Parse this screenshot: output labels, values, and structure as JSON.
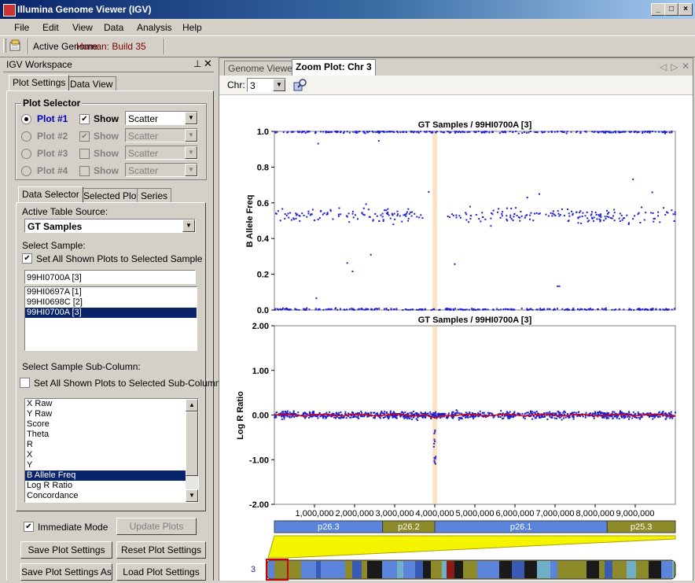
{
  "window": {
    "title": "Illumina Genome Viewer (IGV)"
  },
  "menu": [
    "File",
    "Edit",
    "View",
    "Data",
    "Analysis",
    "Help"
  ],
  "toolbar": {
    "genome_label": "Active Genome:",
    "genome_value": "Human: Build 35"
  },
  "workspace": {
    "title": "IGV Workspace",
    "tabs": [
      "Plot Settings",
      "Data View"
    ],
    "plot_selector": {
      "title": "Plot Selector",
      "rows": [
        {
          "plot": "Plot #1",
          "show": "Show",
          "type": "Scatter",
          "selected": true,
          "show_checked": true,
          "enabled": true
        },
        {
          "plot": "Plot #2",
          "show": "Show",
          "type": "Scatter",
          "selected": false,
          "show_checked": true,
          "enabled": false
        },
        {
          "plot": "Plot #3",
          "show": "Show",
          "type": "Scatter",
          "selected": false,
          "show_checked": false,
          "enabled": false
        },
        {
          "plot": "Plot #4",
          "show": "Show",
          "type": "Scatter",
          "selected": false,
          "show_checked": false,
          "enabled": false
        }
      ]
    },
    "subtabs": [
      "Data Selector",
      "Selected Plot",
      "Series"
    ],
    "table_source_label": "Active Table Source:",
    "table_source_value": "GT Samples",
    "select_sample_label": "Select Sample:",
    "set_all_sample_label": "Set All Shown Plots to Selected Sample",
    "sample_input": "99HI0700A [3]",
    "samples": [
      "99HI0697A [1]",
      "99HI0698C [2]",
      "99HI0700A [3]"
    ],
    "selected_sample_index": 2,
    "subcolumn_label": "Select Sample Sub-Column:",
    "set_all_subcolumn_label": "Set All Shown Plots to Selected Sub-Column",
    "subcolumns": [
      "X Raw",
      "Y Raw",
      "Score",
      "Theta",
      "R",
      "X",
      "Y",
      "B Allele Freq",
      "Log R Ratio",
      "Concordance"
    ],
    "selected_subcolumn_index": 7,
    "immediate_mode": "Immediate Mode",
    "update_plots": "Update Plots",
    "save_settings": "Save Plot Settings",
    "reset_settings": "Reset Plot Settings",
    "save_settings_as": "Save Plot Settings As",
    "load_settings": "Load Plot Settings"
  },
  "viewer": {
    "tabs": [
      "Genome Viewer",
      "Zoom Plot: Chr 3"
    ],
    "chr_label": "Chr:",
    "chr_value": "3",
    "chromosome_number": "3",
    "colors": {
      "points": "#2020d0",
      "trend": "#e00000",
      "highlight": "#fbe3c8"
    }
  },
  "chart_data": [
    {
      "type": "scatter",
      "title": "GT Samples / 99HI0700A [3]",
      "ylabel": "B Allele Freq",
      "ylim": [
        0,
        1
      ],
      "yticks": [
        "0.0",
        "0.2",
        "0.4",
        "0.6",
        "0.8",
        "1.0"
      ],
      "xlim": [
        0,
        10000000
      ],
      "clusters": [
        {
          "name": "homozygous A",
          "y": 0.0
        },
        {
          "name": "heterozygous",
          "y": 0.5
        },
        {
          "name": "homozygous B",
          "y": 1.0
        }
      ]
    },
    {
      "type": "scatter",
      "title": "GT Samples / 99HI0700A [3]",
      "ylabel": "Log R Ratio",
      "ylim": [
        -2,
        2
      ],
      "yticks": [
        "-2.00",
        "-1.00",
        "0.00",
        "1.00",
        "2.00"
      ],
      "xlim": [
        0,
        10000000
      ],
      "xticks": [
        "1,000,000",
        "2,000,000",
        "3,000,000",
        "4,000,000",
        "5,000,000",
        "6,000,000",
        "7,000,000",
        "8,000,000",
        "9,000,000"
      ],
      "dip_position": 4000000,
      "dip_min": -1.1
    }
  ],
  "bands": [
    {
      "name": "p26.3",
      "start": 0,
      "end": 2700000,
      "color": "#5b84dd"
    },
    {
      "name": "p26.2",
      "start": 2700000,
      "end": 4000000,
      "color": "#8d8a2a"
    },
    {
      "name": "p26.1",
      "start": 4000000,
      "end": 8300000,
      "color": "#5b84dd"
    },
    {
      "name": "p25.3",
      "start": 8300000,
      "end": 10000000,
      "color": "#8d8a2a"
    }
  ]
}
